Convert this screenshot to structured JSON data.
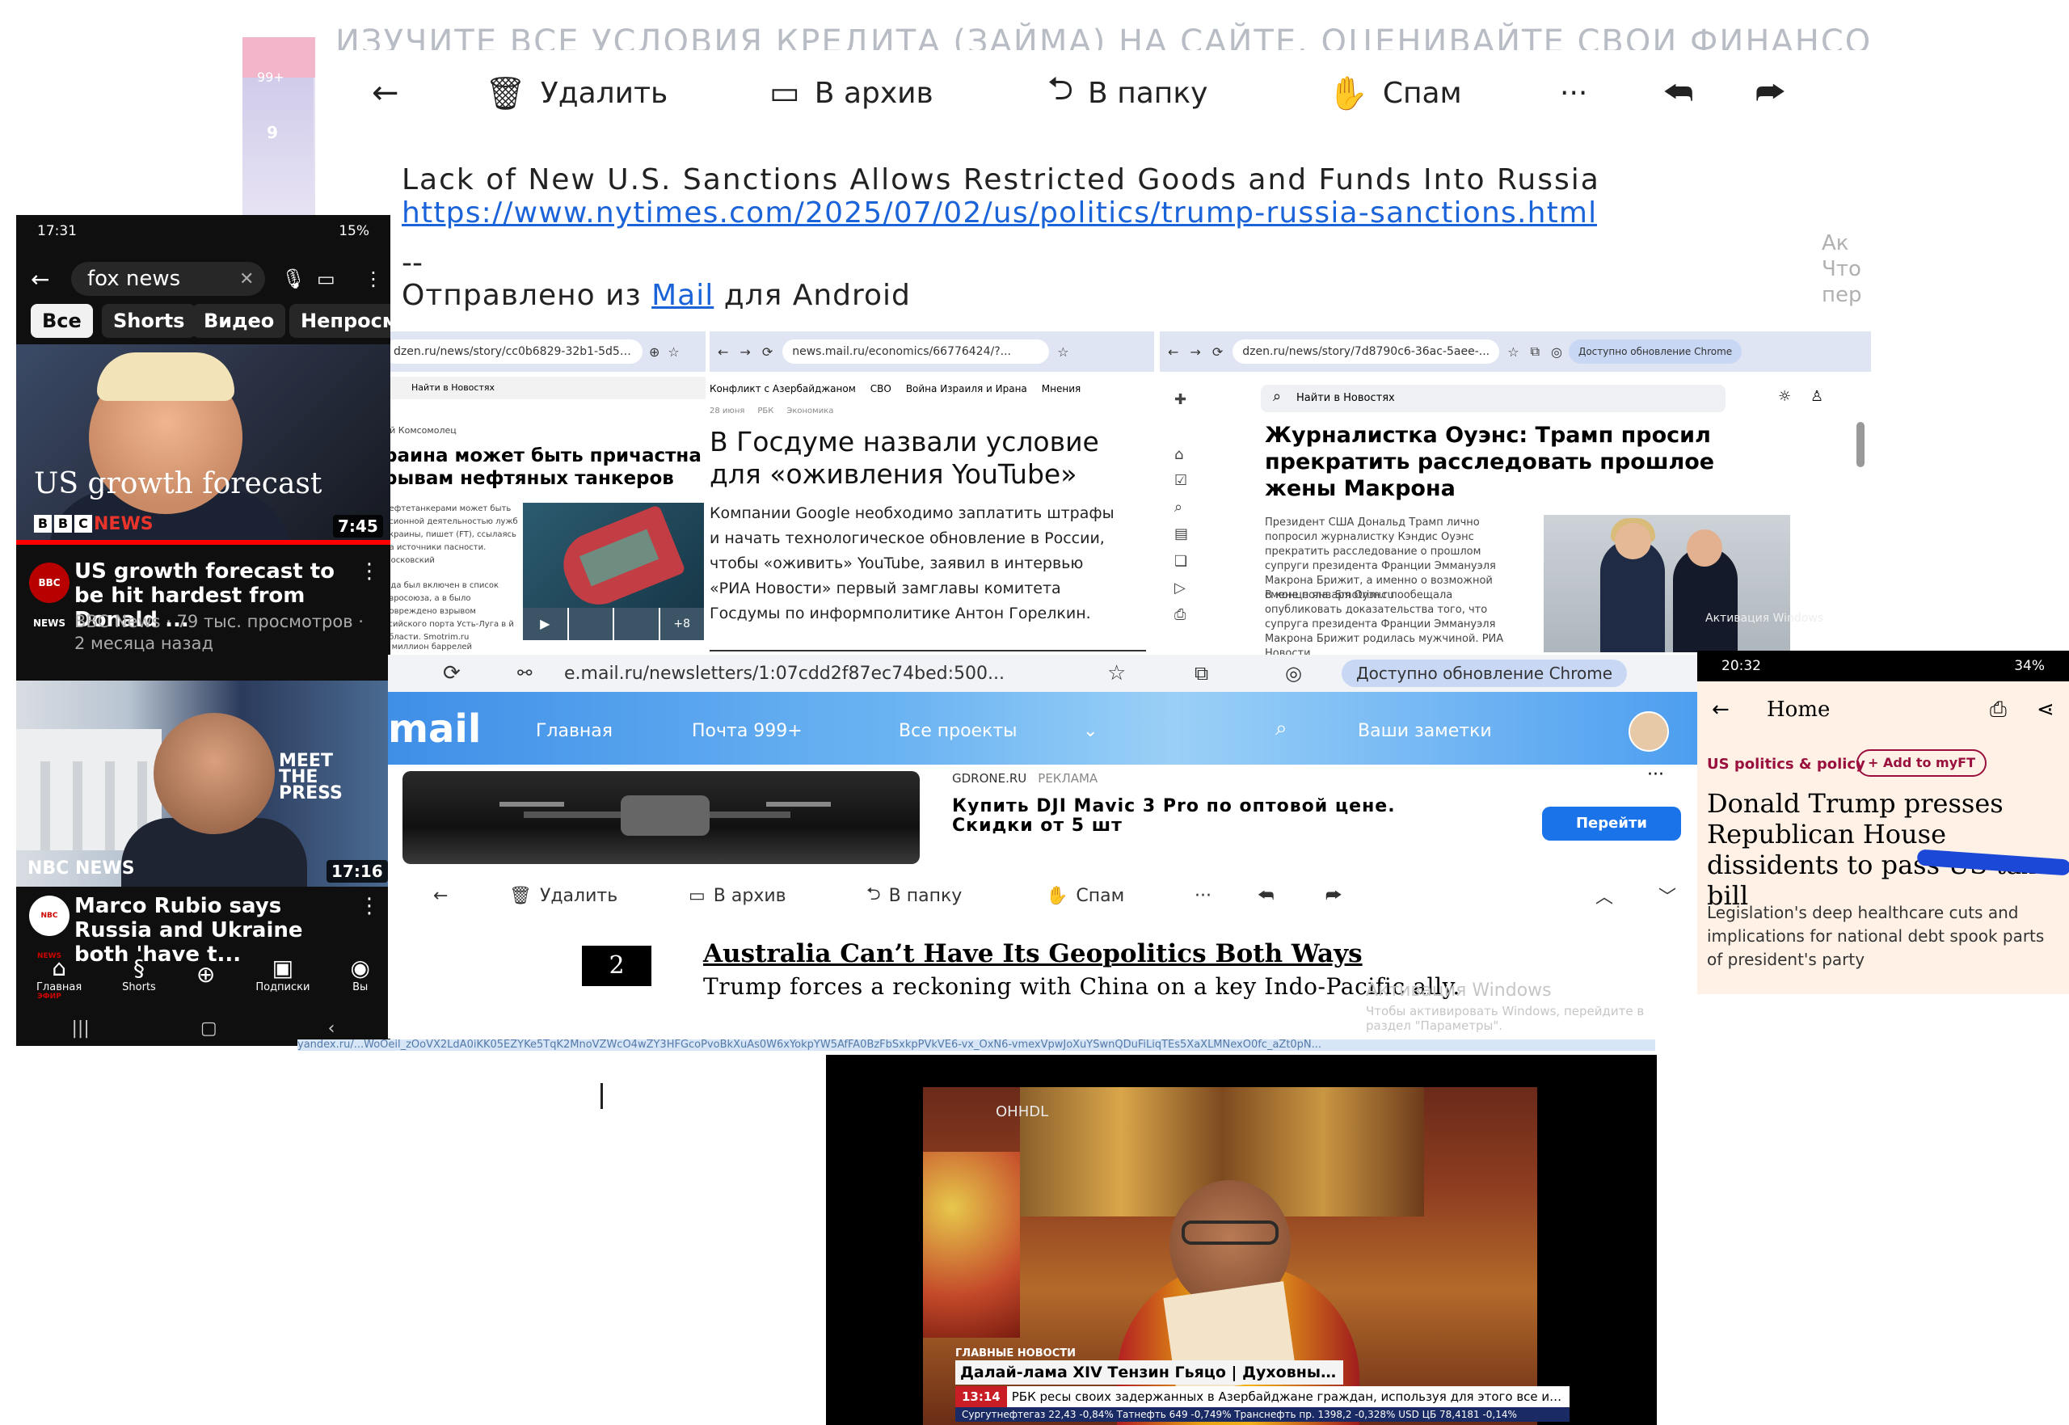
{
  "mail_top": {
    "cut_text": "ИЗУЧИТЕ ВСЕ УСЛОВИЯ КРЕДИТА (ЗАЙМА) НА САЙТЕ. ОЦЕНИВАЙТЕ СВОИ ФИНАНСОВЫ",
    "side_counts": [
      "99+",
      "9"
    ],
    "toolbar": {
      "delete": "Удалить",
      "archive": "В архив",
      "folder": "В папку",
      "spam": "Спам",
      "more": "···"
    },
    "subject": "Lack of New U.S. Sanctions Allows Restricted Goods and Funds Into Russia",
    "link": "https://www.nytimes.com/2025/07/02/us/politics/trump-russia-sanctions.html",
    "sig_dash": "--",
    "sent_prefix": "Отправлено из ",
    "sent_link": "Mail",
    "sent_suffix": " для Android",
    "watermark": [
      "Ак",
      "Что",
      "пер"
    ]
  },
  "youtube": {
    "status_time": "17:31",
    "status_right": "15%",
    "search_query": "fox news",
    "chips": [
      "Все",
      "Shorts",
      "Видео",
      "Непросм"
    ],
    "video1": {
      "overlay_title": "US growth forecast",
      "channel_logo": [
        "B",
        "B",
        "C"
      ],
      "logo_word": "NEWS",
      "duration": "7:45",
      "avatar": "BBC NEWS",
      "title": "US growth forecast to be hit hardest from Donald ...",
      "meta": "BBC News · 79 тыс. просмотров · 2 месяца назад"
    },
    "video2": {
      "overlay_brand": "NBC NEWS",
      "overlay_show": "MEET THE PRESS",
      "duration": "17:16",
      "avatar": "NBC NEWS ЭФИР",
      "title": "Marco Rubio says Russia and Ukraine both 'have t..."
    },
    "nav": [
      {
        "icon": "⌂",
        "label": "Главная"
      },
      {
        "icon": "§",
        "label": "Shorts"
      },
      {
        "icon": "⊕",
        "label": ""
      },
      {
        "icon": "▣",
        "label": "Подписки"
      },
      {
        "icon": "◉",
        "label": "Вы"
      }
    ],
    "sysnav": [
      "|||",
      "▢",
      "‹"
    ]
  },
  "browser": {
    "url_a": "dzen.ru/news/story/cc0b6829-32b1-5d53...",
    "url_b": "news.mail.ru/economics/66776424/?...",
    "url_c": "dzen.ru/news/story/7d8790c6-36ac-5aee-...",
    "update_chip": "Доступно обновление Chrome",
    "col_a": {
      "crumb": "Найти в Новостях",
      "source": "ий Комсомолец",
      "headline": "раина может быть причастна рывам нефтяных танкеров",
      "body": "нефтетанкерами может быть рсионной деятельностью лужб Украины, пишет (FT), ссылаясь на источники пасности. Московский",
      "body2": "юда был включен в список Евросоюза, а в было повреждено взрывом ссийского порта Усть-Луга в й области. Smotrim.ru",
      "body3": "й миллион баррелей",
      "more_count": "+8"
    },
    "col_b": {
      "tags": [
        "Конфликт с Азербайджаном",
        "СВО",
        "Война Израиля и Ирана",
        "Мнения"
      ],
      "date": "28 июня",
      "src": "РБК",
      "cat": "Экономика",
      "headline": "В Госдуме назвали условие для «оживления YouTube»",
      "body": "Компании Google необходимо заплатить штрафы и начать технологическое обновление в России, чтобы «оживить» YouTube, заявил в интервью «РИА Новости» первый замглавы комитета Госдумы по информполитике Антон Горелкин."
    },
    "col_c": {
      "search_placeholder": "Найти в Новостях",
      "headline": "Журналистка Оуэнс: Трамп просил прекратить расследовать прошлое жены Макрона",
      "body": "Президент США Дональд Трамп лично попросил журналистку Кэндис Оуэнс прекратить расследование о прошлом супруги президента Франции Эммануэля Макрона Брижит, а именно о возможной смене пола. Smotrim.ru",
      "body2": "В конце января Оуэнс пообещала опубликовать доказательства того, что супруга президента Франции Эммануэля Макрона Брижит родилась мужчиной. РИА Новости",
      "activation": "Активация Windows"
    }
  },
  "mailru": {
    "url": "e.mail.ru/newsletters/1:07cdd2f87ec74bed:500...",
    "update_chip": "Доступно обновление Chrome",
    "logo": "mail",
    "nav": [
      "Главная",
      "Почта 999+",
      "Все проекты"
    ],
    "notes": "Ваши заметки",
    "ad": {
      "source": "GDRONE.RU",
      "ad_label": "РЕКЛАМА",
      "title": "Купить DJI Mavic 3 Pro по оптовой цене. Скидки от 5 шт",
      "button": "Перейти",
      "more": "···"
    },
    "toolbar": {
      "delete": "Удалить",
      "archive": "В архив",
      "folder": "В папку",
      "spam": "Спам",
      "more": "···"
    },
    "item_number": "2",
    "headline": "Australia Can’t Have Its Geopolitics Both Ways",
    "subline": "Trump forces a reckoning with China on a key Indo-Pacific ally.",
    "activation": "Активация Windows",
    "activation_sub": "Чтобы активировать Windows, перейдите в раздел \"Параметры\".",
    "yandex_line": "yandex.ru/...WoOeil_zOoVX2LdA0iKK05EZYKe5TqK2MnoVZWcO4wZY3HFGcoPvoBkXuAs0W6xYokpYW5AfFA0BzFbSxkpPVkVE6-vx_OxN6-vmexVpwJoXuYSwnQDuFiLiqTEs5XaXLMNexO0fc_aZt0pN..."
  },
  "ft": {
    "status_time": "20:32",
    "status_right": "34%",
    "title": "Home",
    "topic": "US politics & policy",
    "add_button": "+ Add to myFT",
    "headline": "Donald Trump presses Republican House dissidents to pass US tax bill",
    "standfirst": "Legislation's deep healthcare cuts and implications for national debt spook parts of president's party"
  },
  "tv": {
    "corner_tag": "OHHDL",
    "label_top": "ГЛАВНЫЕ НОВОСТИ",
    "name_bar": "Далай-лама XIV Тензин Гьяцо | Духовный лидер Тибета",
    "time": "13:14",
    "ticker": "РБК ресы своих задержанных в Азербайджане граждан, используя для этого все имеющие",
    "quotes": "Сургутнефтегаз 22,43 -0,84%   Татнефть 649 -0,749%   Транснефть пр. 1398,2 -0,328%   USD ЦБ 78,4181 -0,14%"
  }
}
